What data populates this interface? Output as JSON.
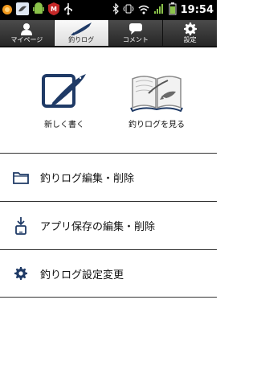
{
  "status_bar": {
    "time": "19:54",
    "left_icons": [
      "notification-dot-icon",
      "bird-app-icon",
      "android-icon",
      "mcafee-icon",
      "usb-icon"
    ],
    "right_icons": [
      "bluetooth-icon",
      "vibrate-icon",
      "wifi-icon",
      "signal-icon",
      "battery-icon"
    ]
  },
  "tabs": [
    {
      "label": "マイページ",
      "icon": "person-icon",
      "active": false
    },
    {
      "label": "釣りログ",
      "icon": "fish-icon",
      "active": true
    },
    {
      "label": "コメント",
      "icon": "speech-bubble-icon",
      "active": false
    },
    {
      "label": "設定",
      "icon": "gear-icon",
      "active": false
    }
  ],
  "actions": {
    "new": {
      "label": "新しく書く",
      "icon": "fish-compose-icon"
    },
    "view": {
      "label": "釣りログを見る",
      "icon": "fish-book-icon"
    }
  },
  "menu": [
    {
      "label": "釣りログ編集・削除",
      "icon": "folder-icon"
    },
    {
      "label": "アプリ保存の編集・削除",
      "icon": "download-phone-icon"
    },
    {
      "label": "釣りログ設定変更",
      "icon": "gear-icon"
    }
  ],
  "colors": {
    "accent": "#1f3a66",
    "tab_bg": "#3a3a3a",
    "active_tab_bg": "#f0f0f0"
  }
}
